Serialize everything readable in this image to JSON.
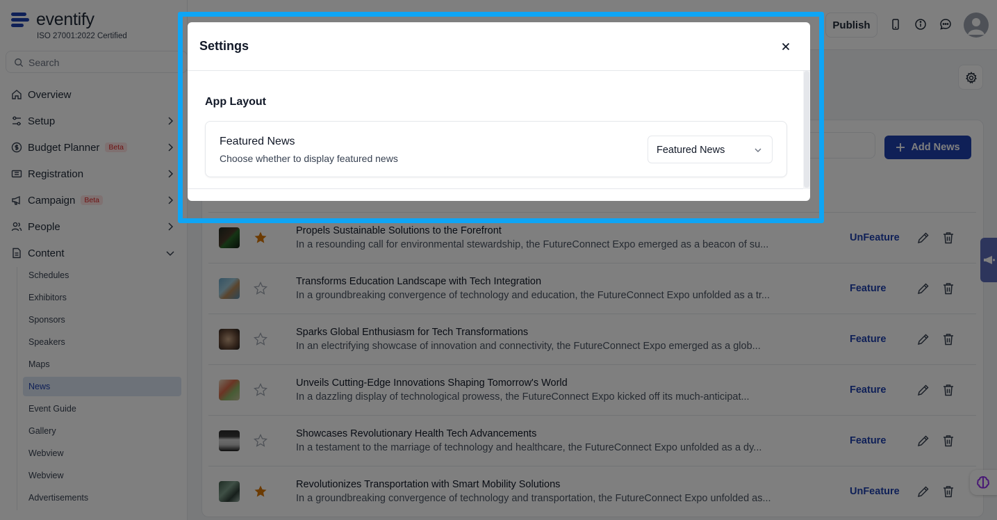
{
  "brand": {
    "name": "eventify",
    "subtitle": "ISO 27001:2022 Certified",
    "color": "#1e40af"
  },
  "search": {
    "placeholder": "Search"
  },
  "sidebar": {
    "items": [
      {
        "label": "Overview",
        "icon": "home-icon"
      },
      {
        "label": "Setup",
        "icon": "sliders-icon"
      },
      {
        "label": "Budget Planner",
        "icon": "dollar-circle-icon",
        "badge": "Beta"
      },
      {
        "label": "Registration",
        "icon": "ticket-icon"
      },
      {
        "label": "Campaign",
        "icon": "megaphone-icon",
        "badge": "Beta"
      },
      {
        "label": "People",
        "icon": "users-icon"
      },
      {
        "label": "Content",
        "icon": "file-icon"
      }
    ],
    "content_children": [
      "Schedules",
      "Exhibitors",
      "Sponsors",
      "Speakers",
      "Maps",
      "News",
      "Event Guide",
      "Gallery",
      "Webview",
      "Webview",
      "Advertisements"
    ]
  },
  "topbar": {
    "publish_label": "Publish"
  },
  "main": {
    "add_button_label": "Add News",
    "news": [
      {
        "title": "Propels Sustainable Solutions to the Forefront",
        "desc": "In a resounding call for environmental stewardship, the FutureConnect Expo emerged as a beacon of su...",
        "featured": true,
        "action": "UnFeature"
      },
      {
        "title": "Transforms Education Landscape with Tech Integration",
        "desc": "In a groundbreaking convergence of technology and education, the FutureConnect Expo unfolded as a tr...",
        "featured": false,
        "action": "Feature"
      },
      {
        "title": "Sparks Global Enthusiasm for Tech Transformations",
        "desc": "In an electrifying showcase of innovation and connectivity, the FutureConnect Expo emerged as a glob...",
        "featured": false,
        "action": "Feature"
      },
      {
        "title": "Unveils Cutting-Edge Innovations Shaping Tomorrow's World",
        "desc": "In a dazzling display of technological prowess, the FutureConnect Expo kicked off its much-anticipat...",
        "featured": false,
        "action": "Feature"
      },
      {
        "title": "Showcases Revolutionary Health Tech Advancements",
        "desc": "In a testament to the marriage of technology and healthcare, the FutureConnect Expo unfolded as a dy...",
        "featured": false,
        "action": "Feature"
      },
      {
        "title": "Revolutionizes Transportation with Smart Mobility Solutions",
        "desc": "In a groundbreaking convergence of technology and transportation, the FutureConnect Expo unfolded as...",
        "featured": true,
        "action": "UnFeature"
      }
    ]
  },
  "modal": {
    "title": "Settings",
    "section_title": "App Layout",
    "setting": {
      "label": "Featured News",
      "description": "Choose whether to display featured news",
      "selected": "Featured News"
    }
  },
  "colors": {
    "accent": "#1e40af",
    "star": "#d97706",
    "highlight": "#0ea5f5"
  }
}
